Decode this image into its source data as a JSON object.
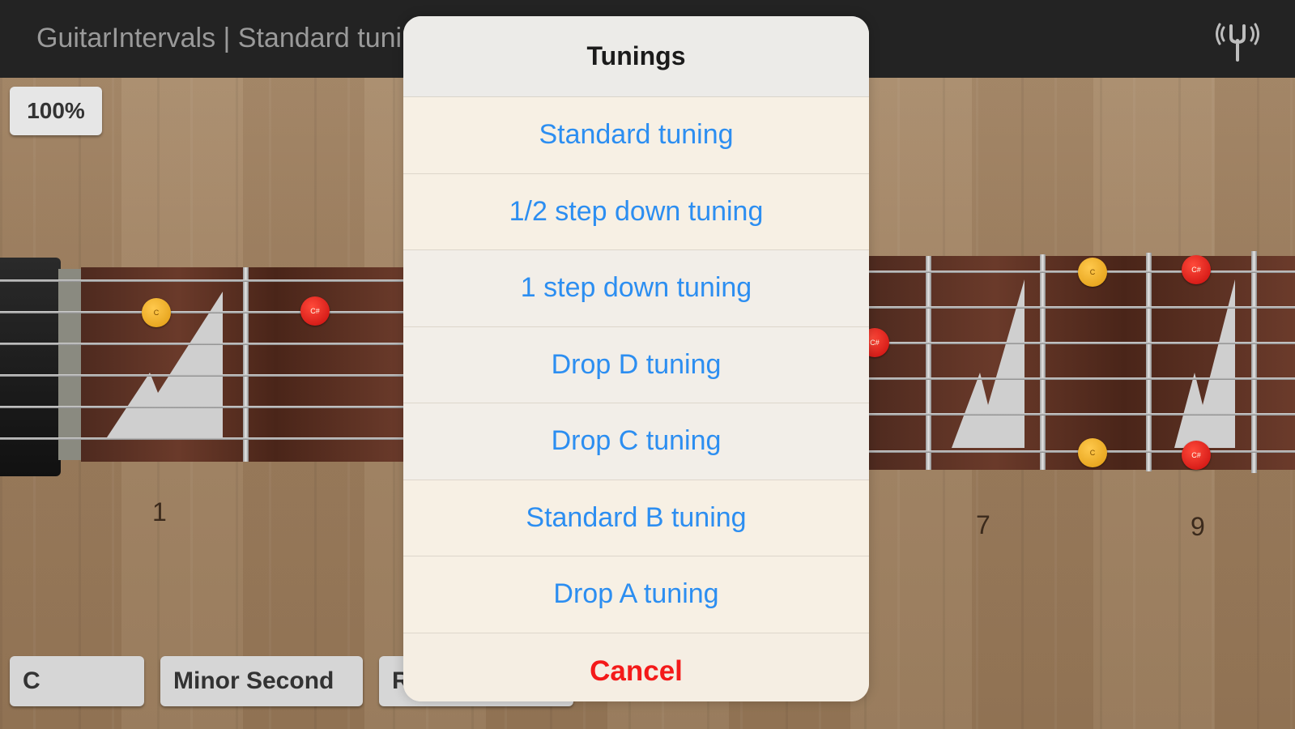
{
  "app_title": "GuitarIntervals | Standard tuning",
  "zoom_label": "100%",
  "fret_numbers": [
    "1",
    "7",
    "9"
  ],
  "note_labels": {
    "root": "C",
    "interval": "C#"
  },
  "bottom_controls": {
    "root_note": "C",
    "interval": "Minor Second",
    "third_label": "R"
  },
  "tunings_sheet": {
    "title": "Tunings",
    "options": [
      "Standard tuning",
      "1/2 step down tuning",
      "1 step down tuning",
      "Drop D tuning",
      "Drop C tuning",
      "Standard B tuning",
      "Drop A tuning"
    ],
    "cancel_label": "Cancel"
  },
  "colors": {
    "accent_blue": "#2c8ef1",
    "cancel_red": "#f41a1a",
    "root_dot": "#f0a818",
    "interval_dot": "#dd1010"
  },
  "icons": [
    "tuning-fork-icon"
  ]
}
